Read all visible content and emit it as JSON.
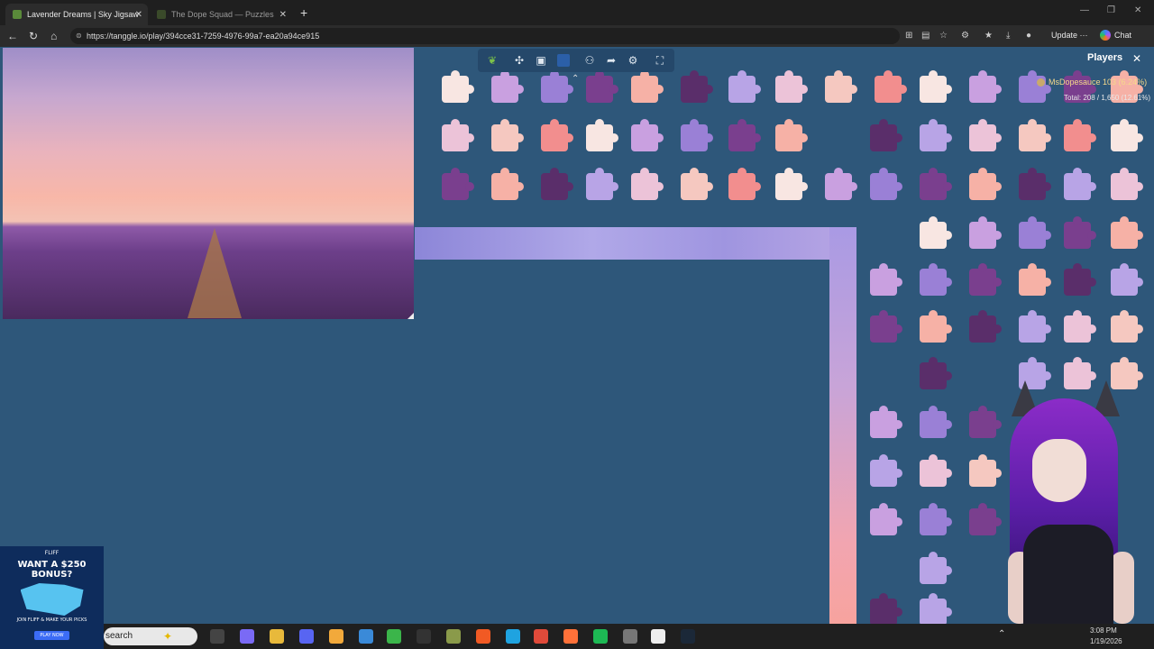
{
  "browser": {
    "tabs": [
      {
        "title": "Lavender Dreams | Sky Jigsaw",
        "active": true
      },
      {
        "title": "The Dope Squad — Puzzles",
        "active": false
      }
    ],
    "url": "https://tanggle.io/play/394cce31-7259-4976-99a7-ea20a94ce915",
    "update_label": "Update",
    "chat_label": "Chat"
  },
  "game": {
    "players_label": "Players",
    "player": {
      "name": "MsDopesauce",
      "score": "103 (6.24%)"
    },
    "total": "Total: 208 / 1,650 (12.61%)",
    "toolbar_icons": [
      "leaf-icon",
      "puzzle-piece-icon",
      "image-icon",
      "color-swatch",
      "players-icon",
      "share-icon",
      "settings-icon",
      "fullscreen-icon"
    ],
    "accent": "#2b5fa8",
    "background": "#2e577a"
  },
  "ad": {
    "brand": "FLIFF",
    "headline": "WANT A $250 BONUS?",
    "subtext": "JOIN FLIFF & MAKE YOUR PICKS",
    "cta": "PLAY NOW"
  },
  "taskbar": {
    "search_label": "search",
    "time": "3:08 PM",
    "date": "1/19/2026"
  }
}
